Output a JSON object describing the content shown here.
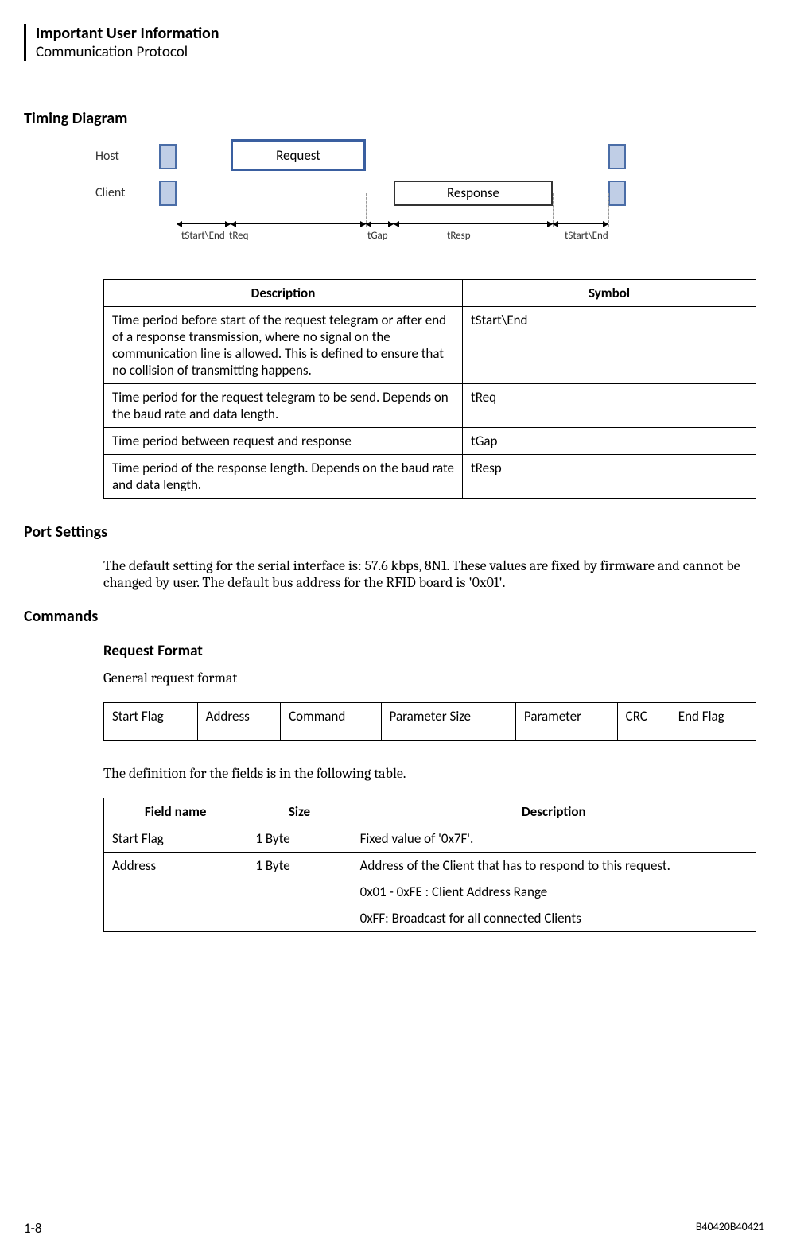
{
  "header": {
    "title": "Important User Information",
    "subtitle": "Communication Protocol"
  },
  "section1_title": "Timing Diagram",
  "diagram": {
    "host_label": "Host",
    "client_label": "Client",
    "request_label": "Request",
    "response_label": "Response",
    "ticks": {
      "tstartend_left": "tStart\\End",
      "treq": "tReq",
      "tgap": "tGap",
      "tresp": "tResp",
      "tstartend_right": "tStart\\End"
    }
  },
  "timing_table": {
    "headers": [
      "Description",
      "Symbol"
    ],
    "rows": [
      {
        "desc": "Time period before start of the request telegram or after end of a response transmission, where no signal on the communication line is allowed. This is defined to ensure that no collision of transmitting happens.",
        "sym": "tStart\\End"
      },
      {
        "desc": "Time period for the request telegram to be send. Depends on the baud rate and data length.",
        "sym": "tReq"
      },
      {
        "desc": "Time period between request and response",
        "sym": "tGap"
      },
      {
        "desc": "Time period of the response length. Depends on the baud rate and data length.",
        "sym": "tResp"
      }
    ]
  },
  "section2_title": "Port Settings",
  "port_settings_text": "The default setting for the serial interface is: 57.6 kbps, 8N1. These values are fixed by firmware and cannot be changed by user. The default bus address for the RFID board is '0x01'.",
  "section3_title": "Commands",
  "request_format_title": "Request Format",
  "request_format_sub": "General request format",
  "format_cells": [
    "Start Flag",
    "Address",
    "Command",
    "Parameter Size",
    "Parameter",
    "CRC",
    "End Flag"
  ],
  "field_intro": "The definition for the fields is in the following table.",
  "field_table": {
    "headers": [
      "Field name",
      "Size",
      "Description"
    ],
    "rows": [
      {
        "name": "Start Flag",
        "size": "1 Byte",
        "desc_lines": [
          "Fixed value of '0x7F'."
        ]
      },
      {
        "name": "Address",
        "size": "1 Byte",
        "desc_lines": [
          "Address of the Client that has to respond to this request.",
          "0x01 - 0xFE : Client Address Range",
          "0xFF: Broadcast for all connected Clients"
        ]
      }
    ]
  },
  "footer": {
    "page": "1-8",
    "doc_id": "B40420B40421"
  }
}
